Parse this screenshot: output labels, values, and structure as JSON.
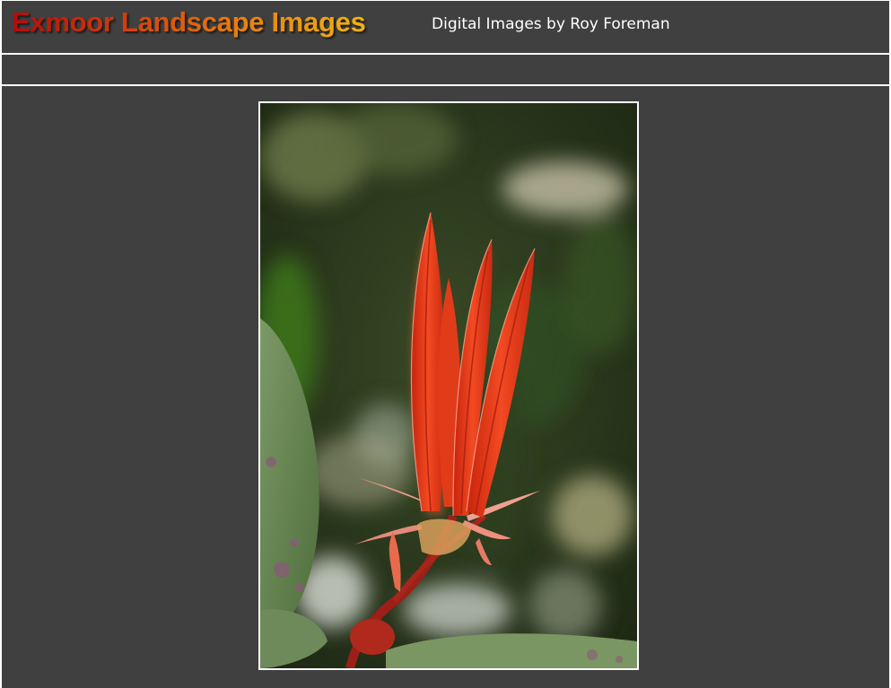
{
  "header": {
    "title": "Exmoor Landscape Images",
    "subtitle": "Digital Images by Roy Foreman"
  },
  "colors": {
    "background": "#404040",
    "rule": "#ffffff",
    "title_gradient_start": "#b30c0c",
    "title_gradient_end": "#f0b313"
  },
  "photo": {
    "subject": "red-leaf-shoot-photo"
  }
}
